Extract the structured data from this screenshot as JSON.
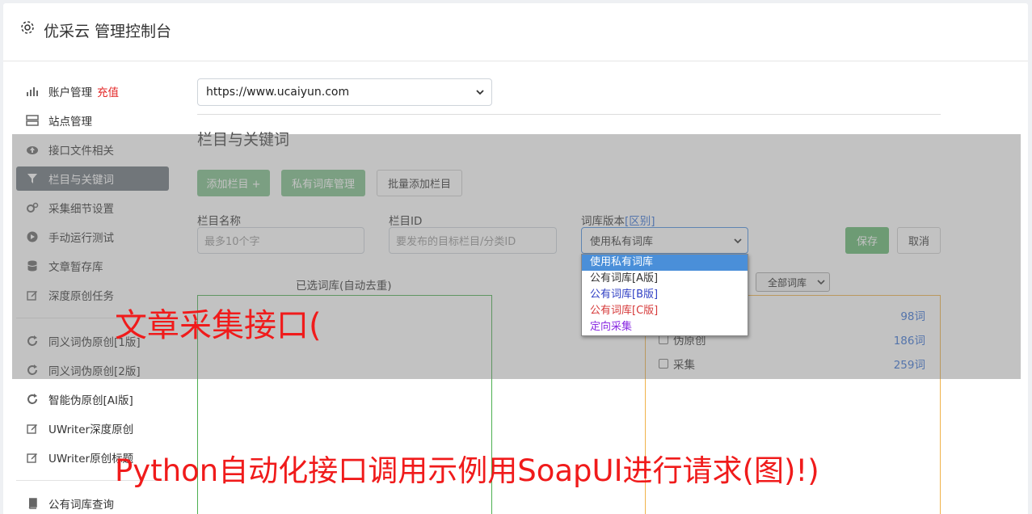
{
  "app": {
    "title": "优采云 管理控制台"
  },
  "sidebar": {
    "items": [
      {
        "label": "账户管理",
        "accent": "充值",
        "icon": "bar-chart-icon"
      },
      {
        "label": "站点管理",
        "icon": "server-icon"
      },
      {
        "label": "接口文件相关",
        "icon": "cloud-upload-icon"
      },
      {
        "label": "栏目与关键词",
        "icon": "filter-icon"
      },
      {
        "label": "采集细节设置",
        "icon": "cogs-icon"
      },
      {
        "label": "手动运行测试",
        "icon": "play-circle-icon"
      },
      {
        "label": "文章暂存库",
        "icon": "database-icon"
      },
      {
        "label": "深度原创任务",
        "icon": "edit-icon"
      },
      {
        "label": "同义词伪原创[1版]",
        "icon": "refresh-icon"
      },
      {
        "label": "同义词伪原创[2版]",
        "icon": "refresh-icon"
      },
      {
        "label": "智能伪原创[AI版]",
        "icon": "refresh-icon"
      },
      {
        "label": "UWriter深度原创",
        "icon": "edit-icon"
      },
      {
        "label": "UWriter原创标题",
        "icon": "edit-icon"
      },
      {
        "label": "公有词库查询",
        "icon": "book-icon"
      }
    ]
  },
  "site_select": {
    "value": "https://www.ucaiyun.com"
  },
  "section": {
    "title": "栏目与关键词",
    "buttons": {
      "add_column": "添加栏目 +",
      "private_lib": "私有词库管理",
      "batch_add": "批量添加栏目"
    }
  },
  "form": {
    "column_name": {
      "label": "栏目名称",
      "placeholder": "最多10个字"
    },
    "column_id": {
      "label": "栏目ID",
      "placeholder": "要发布的目标栏目/分类ID"
    },
    "lib_version": {
      "label": "词库版本",
      "label_link": "[区别]",
      "value": "使用私有词库"
    },
    "save": "保存",
    "cancel": "取消"
  },
  "dropdown": {
    "options": [
      {
        "label": "使用私有词库",
        "color": "#ffffff"
      },
      {
        "label": "公有词库[A版]",
        "color": "#333333"
      },
      {
        "label": "公有词库[B版]",
        "color": "#2f3fc4"
      },
      {
        "label": "公有词库[C版]",
        "color": "#d63a3a"
      },
      {
        "label": "定向采集",
        "color": "#8a2be2"
      }
    ]
  },
  "panels": {
    "selected_caption": "已选词库(自动去重)",
    "filter_value": "全部词库",
    "libraries": [
      {
        "label": "",
        "count": "98词"
      },
      {
        "label": "伪原创",
        "count": "186词"
      },
      {
        "label": "采集",
        "count": "259词"
      }
    ]
  },
  "watermarks": {
    "top": "文章采集接口(",
    "bottom": "Python自动化接口调用示例用SoapUI进行请求(图)!)"
  }
}
